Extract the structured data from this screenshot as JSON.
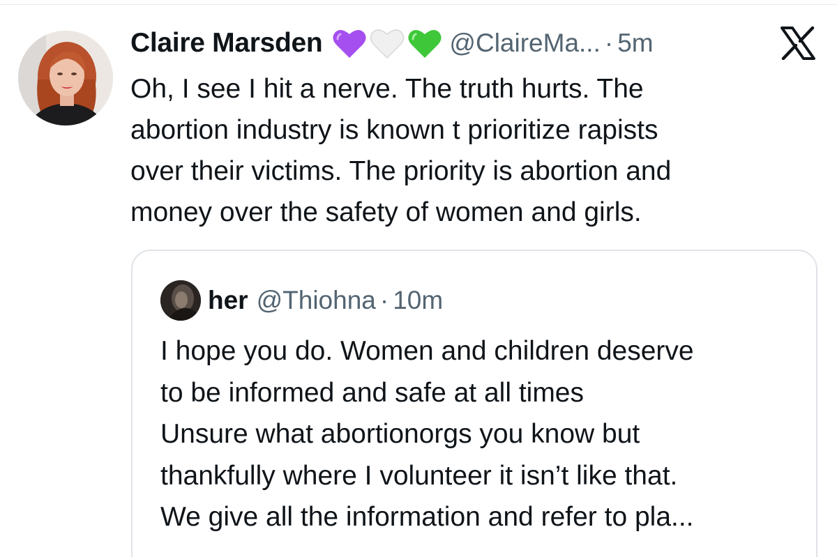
{
  "tweet": {
    "author": {
      "display_name": "Claire Marsden",
      "handle": "@ClaireMa...",
      "emoji_hearts": [
        "purple-heart",
        "white-heart",
        "green-heart"
      ]
    },
    "separator": "·",
    "time": "5m",
    "platform_logo": "x-logo-icon",
    "text_lines": [
      "Oh, I see I hit a nerve. The truth hurts. The",
      "abortion industry is known t prioritize rapists",
      "over their victims. The priority is abortion and",
      "money over the safety of women and girls."
    ]
  },
  "quoted_tweet": {
    "author": {
      "display_name": "her",
      "handle": "@Thiohna"
    },
    "separator": "·",
    "time": "10m",
    "text_lines": [
      "I hope you do. Women and children deserve",
      "to be informed and safe at all times",
      "Unsure what abortionorgs  you know but",
      "thankfully where I volunteer it isn’t like that.",
      "We give all the information and refer to pla..."
    ]
  },
  "colors": {
    "text_primary": "#0f1419",
    "text_secondary": "#536471",
    "border": "#dfe3e7",
    "purple_heart": "#a64ff0",
    "white_heart": "#f0f0f0",
    "green_heart": "#3fc73a"
  }
}
